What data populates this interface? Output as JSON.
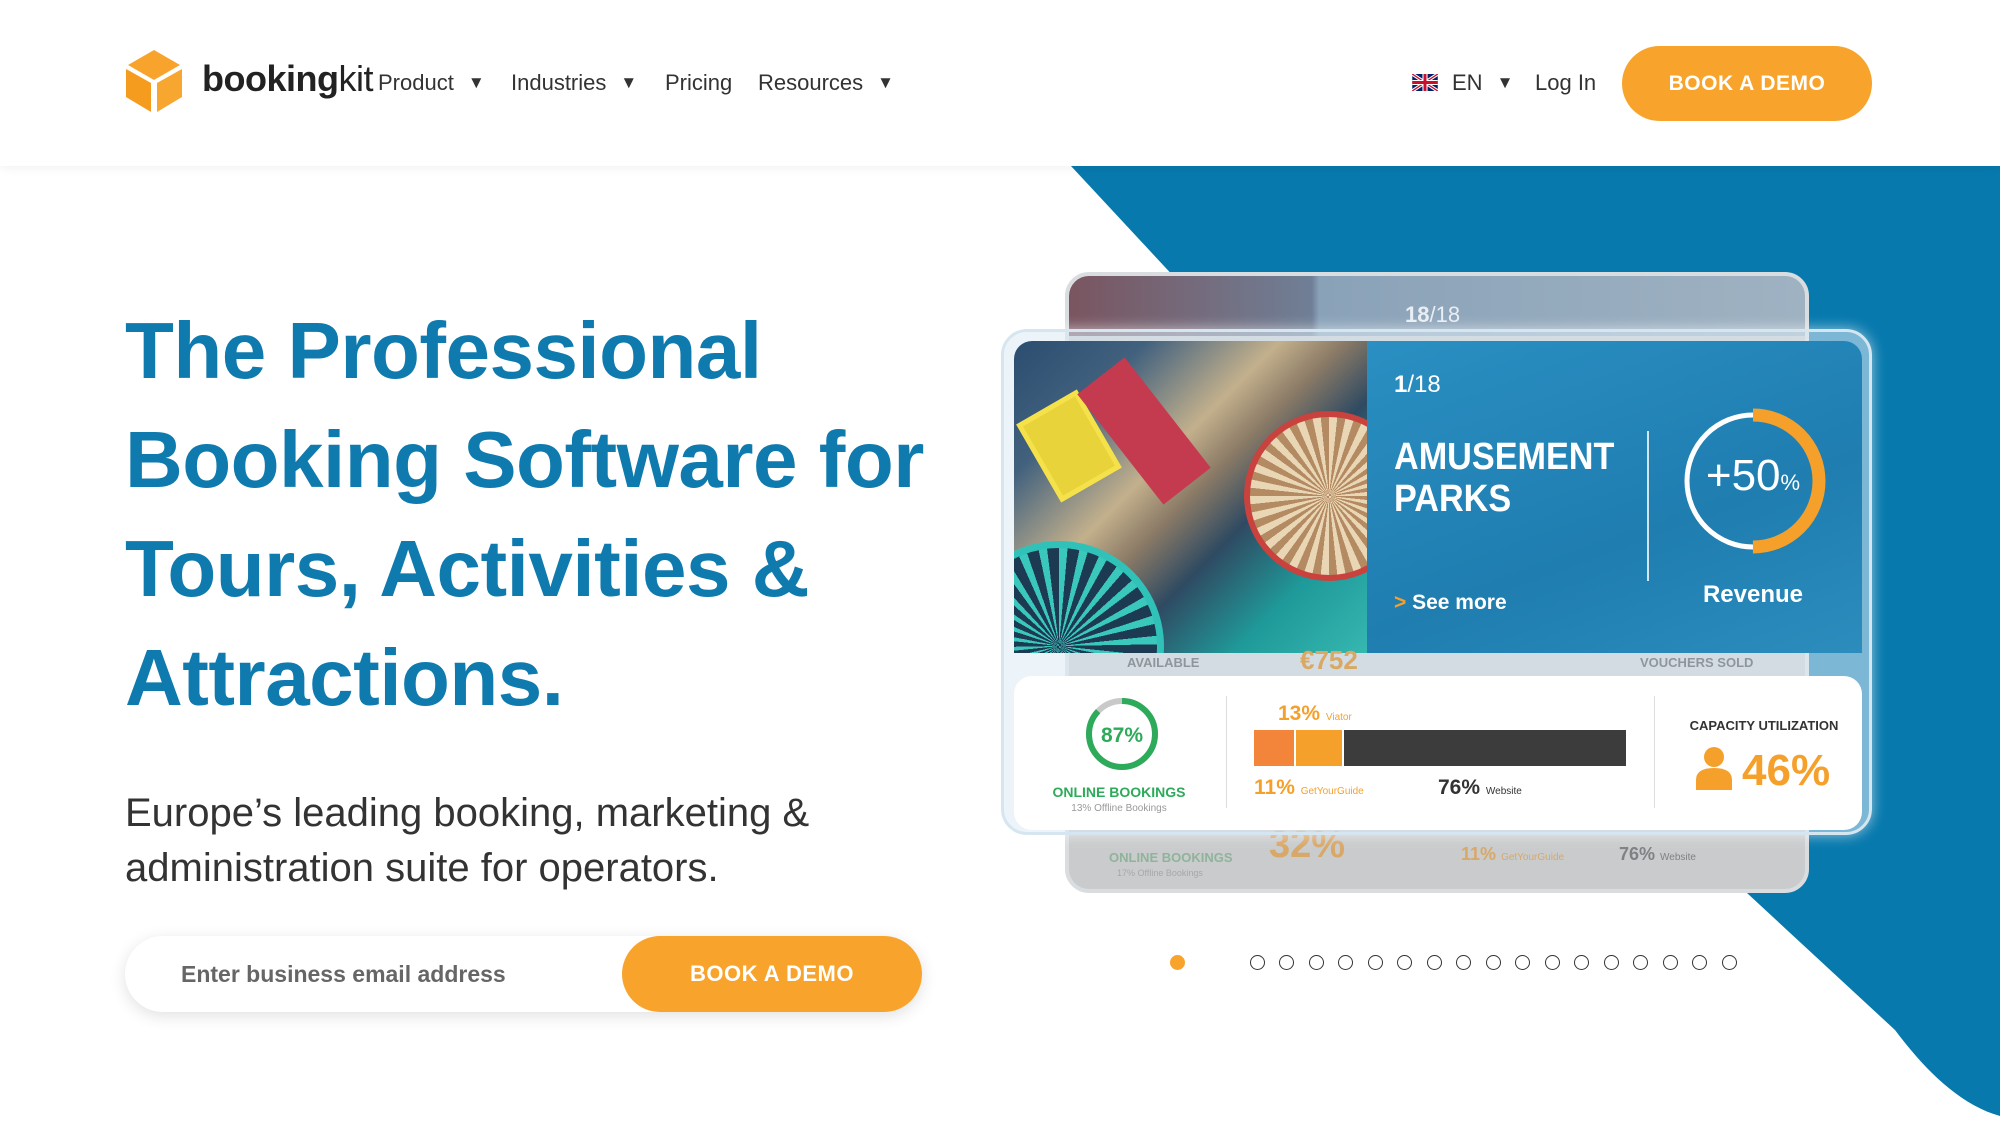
{
  "nav": {
    "brand_bold": "booking",
    "brand_light": "kit",
    "items": [
      {
        "label": "Product",
        "dropdown": true
      },
      {
        "label": "Industries",
        "dropdown": true
      },
      {
        "label": "Pricing",
        "dropdown": false
      },
      {
        "label": "Resources",
        "dropdown": true
      }
    ],
    "language": "EN",
    "login": "Log In",
    "cta": "BOOK A DEMO"
  },
  "hero": {
    "title_lines": [
      "The Professional",
      "Booking Software for",
      "Tours, Activities &",
      "Attractions."
    ],
    "subtitle_lines": [
      "Europe’s leading booking, marketing &",
      "administration suite for operators."
    ],
    "email_placeholder": "Enter business email address",
    "cta": "BOOK A DEMO"
  },
  "slider": {
    "total_slides": 18,
    "active_slide": 1,
    "back_card": {
      "counter_current": "18",
      "counter_total": "/18",
      "stats": [
        "AVAILABLE",
        "€752",
        "VOUCHERS SOLD",
        "ONLINE BOOKINGS",
        "17% Offline Bookings",
        "32%",
        "11%",
        "GetYourGuide",
        "76%",
        "Website"
      ]
    },
    "front_card": {
      "counter_current": "1",
      "counter_total": "/18",
      "industry_line1": "AMUSEMENT",
      "industry_line2": "PARKS",
      "see_more": "See more",
      "ring_value": "+50",
      "ring_unit": "%",
      "ring_fraction": 0.5,
      "ring_label": "Revenue",
      "online_percent": "87%",
      "online_fraction": 0.87,
      "online_label": "ONLINE BOOKINGS",
      "offline_label": "13% Offline Bookings",
      "channels": [
        {
          "value": "13%",
          "name": "Viator"
        },
        {
          "value": "11%",
          "name": "GetYourGuide"
        },
        {
          "value": "76%",
          "name": "Website"
        }
      ],
      "capacity_label": "CAPACITY UTILIZATION",
      "capacity_value": "46%"
    }
  },
  "colors": {
    "brand_blue": "#0f7aad",
    "accent_orange": "#f8a42c",
    "online_green": "#2daa5a",
    "hero_bg_blue": "#0779ad"
  }
}
